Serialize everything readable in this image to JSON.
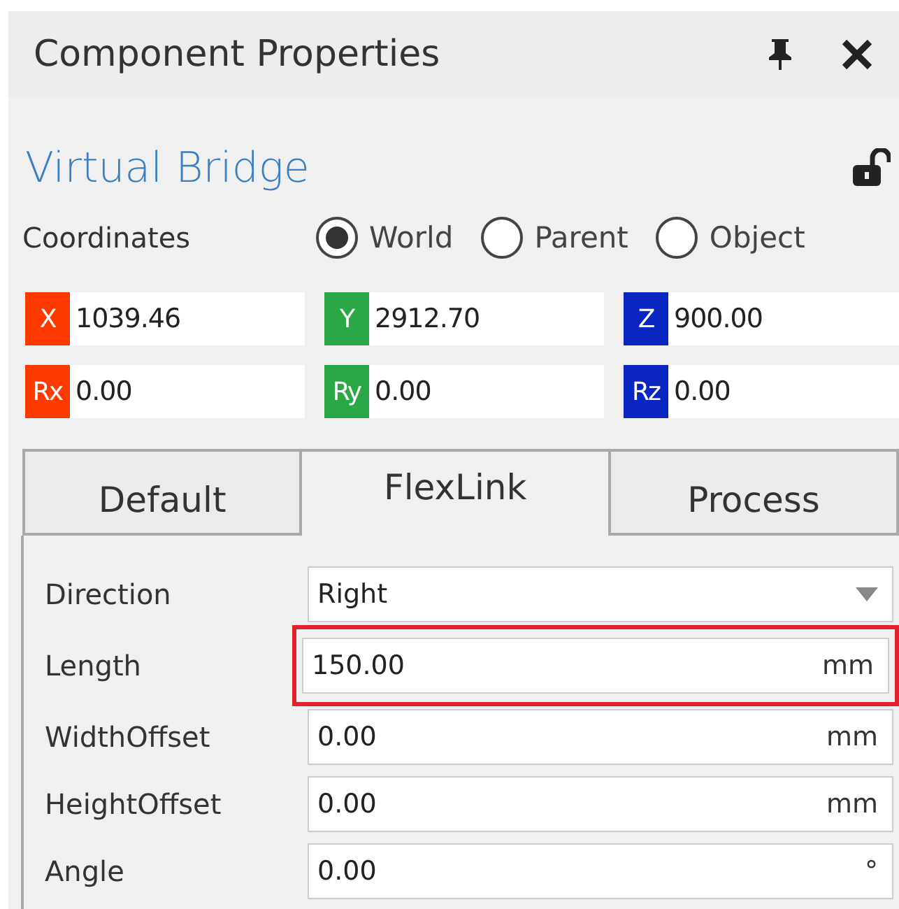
{
  "panel": {
    "title": "Component Properties"
  },
  "component": {
    "name": "Virtual Bridge",
    "locked": false
  },
  "coordinates": {
    "label": "Coordinates",
    "options": [
      {
        "label": "World",
        "selected": true
      },
      {
        "label": "Parent",
        "selected": false
      },
      {
        "label": "Object",
        "selected": false
      }
    ]
  },
  "position": [
    {
      "axis": "X",
      "value": "1039.46",
      "color": "#ff3a00"
    },
    {
      "axis": "Y",
      "value": "2912.70",
      "color": "#2aa845"
    },
    {
      "axis": "Z",
      "value": "900.00",
      "color": "#0a26c0"
    }
  ],
  "rotation": [
    {
      "axis": "Rx",
      "value": "0.00",
      "color": "#ff3a00"
    },
    {
      "axis": "Ry",
      "value": "0.00",
      "color": "#2aa845"
    },
    {
      "axis": "Rz",
      "value": "0.00",
      "color": "#0a26c0"
    }
  ],
  "tabs": [
    {
      "label": "Default",
      "selected": false
    },
    {
      "label": "FlexLink",
      "selected": true
    },
    {
      "label": "Process",
      "selected": false
    }
  ],
  "properties": [
    {
      "label": "Direction",
      "kind": "dropdown",
      "value": "Right",
      "highlighted": false
    },
    {
      "label": "Length",
      "kind": "field",
      "value": "150.00",
      "unit": "mm",
      "highlighted": true
    },
    {
      "label": "WidthOffset",
      "kind": "field",
      "value": "0.00",
      "unit": "mm",
      "highlighted": false
    },
    {
      "label": "HeightOffset",
      "kind": "field",
      "value": "0.00",
      "unit": "mm",
      "highlighted": false
    },
    {
      "label": "Angle",
      "kind": "field",
      "value": "0.00",
      "unit": "°",
      "highlighted": false
    }
  ]
}
